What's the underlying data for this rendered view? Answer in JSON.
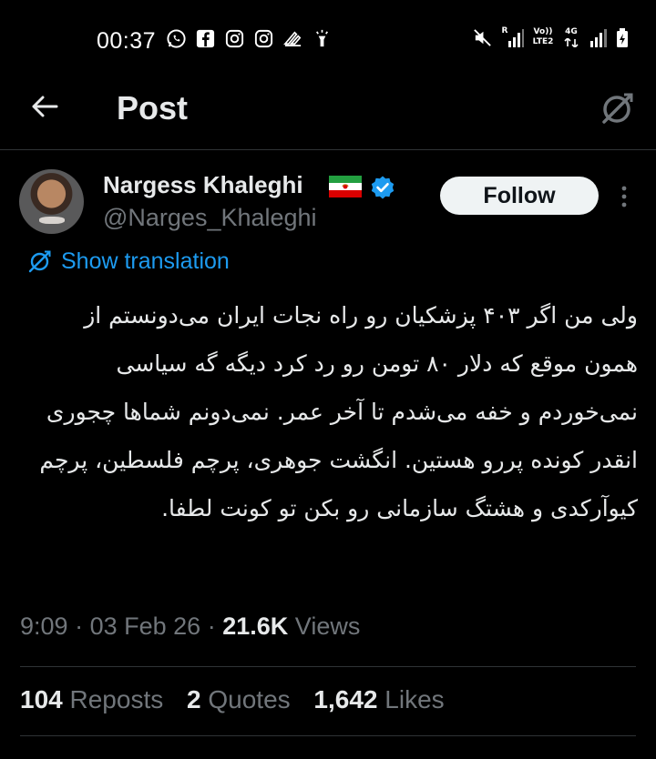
{
  "status_bar": {
    "time": "00:37",
    "left_icons": [
      "whatsapp-icon",
      "facebook-icon",
      "instagram-icon",
      "instagram-icon",
      "app-icon",
      "torch-icon"
    ],
    "right_icons": [
      "mute-icon",
      "signal-icon",
      "volte-icon",
      "data-4g-icon",
      "signal-icon",
      "battery-icon"
    ],
    "roaming_label": "R",
    "volte_label": "Vo))",
    "lte_label": "LTE2",
    "network_label": "4G"
  },
  "header": {
    "title": "Post"
  },
  "tweet": {
    "author": {
      "display_name": "Nargess Khaleghi",
      "handle": "@Narges_Khaleghi"
    },
    "follow_label": "Follow",
    "show_translation_label": "Show translation",
    "text": "ولی من اگر ۴۰۳ پزشکیان رو راه نجات ایران می‌دونستم از همون موقع که دلار ۸۰ تومن رو رد کرد دیگه گه سیاسی نمی‌خوردم و خفه می‌شدم تا آخر عمر. نمی‌دونم شماها چجوری انقدر کونده پررو هستین. انگشت جوهری، پرچم فلسطین، پرچم کیوآرکدی و هشتگ سازمانی رو بکن تو کونت لطفا.",
    "time": "9:09",
    "date": "03 Feb 26",
    "separator": "·",
    "views_count": "21.6K",
    "views_label": "Views",
    "stats": {
      "reposts_count": "104",
      "reposts_label": "Reposts",
      "quotes_count": "2",
      "quotes_label": "Quotes",
      "likes_count": "1,642",
      "likes_label": "Likes"
    }
  },
  "colors": {
    "background": "#000000",
    "text": "#e7e9ea",
    "secondary_text": "#71767b",
    "link": "#1d9bf0",
    "verified": "#1d9bf0",
    "divider": "#2f3336",
    "follow_bg": "#eff3f4"
  }
}
